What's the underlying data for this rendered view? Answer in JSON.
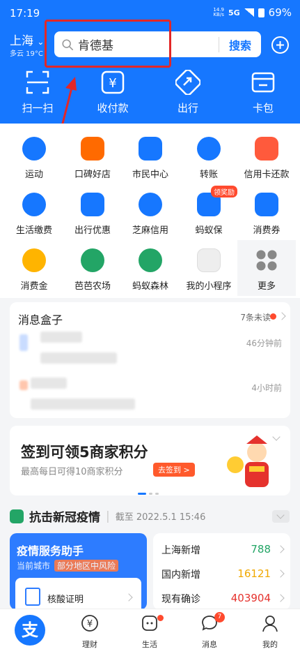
{
  "status": {
    "time": "17:19",
    "network_speed": "14.9",
    "network_unit": "KB/s",
    "signal": "5G",
    "battery": "69%"
  },
  "location": {
    "city": "上海",
    "weather": "多云 19°C"
  },
  "search": {
    "value": "肯德基",
    "button": "搜索"
  },
  "quick_actions": [
    "扫一扫",
    "收付款",
    "出行",
    "卡包"
  ],
  "grid": [
    {
      "label": "运动",
      "color": "#1677ff"
    },
    {
      "label": "口碑好店",
      "color": "#ff6a00"
    },
    {
      "label": "市民中心",
      "color": "#1677ff"
    },
    {
      "label": "转账",
      "color": "#1677ff"
    },
    {
      "label": "信用卡还款",
      "color": "#ff5a3c"
    },
    {
      "label": "生活缴费",
      "color": "#1677ff"
    },
    {
      "label": "出行优惠",
      "color": "#1677ff"
    },
    {
      "label": "芝麻信用",
      "color": "#1677ff"
    },
    {
      "label": "蚂蚁保",
      "color": "#1677ff",
      "badge": "领奖励"
    },
    {
      "label": "消费券",
      "color": "#1677ff"
    },
    {
      "label": "消费金",
      "color": "#ffb400"
    },
    {
      "label": "芭芭农场",
      "color": "#23a566"
    },
    {
      "label": "蚂蚁森林",
      "color": "#23a566"
    },
    {
      "label": "我的小程序",
      "color": "#eeeeee"
    },
    {
      "label": "更多",
      "color": "#888888"
    }
  ],
  "messages": {
    "title": "消息盒子",
    "unread": "7条未读",
    "items": [
      {
        "time": "46分钟前"
      },
      {
        "time": "4小时前"
      }
    ]
  },
  "promo": {
    "title": "签到可领5商家积分",
    "subtitle": "最高每日可得10商家积分",
    "button": "去签到 >"
  },
  "covid": {
    "title": "抗击新冠疫情",
    "date": "截至 2022.5.1 15:46",
    "assistant": {
      "title": "疫情服务助手",
      "city_label": "当前城市",
      "risk": "部分地区中风险",
      "item": "核酸证明"
    },
    "stats": [
      {
        "label": "上海新增",
        "value": "788",
        "color": "#23a566"
      },
      {
        "label": "国内新增",
        "value": "16121",
        "color": "#f0a800"
      },
      {
        "label": "现有确诊",
        "value": "403904",
        "color": "#e5322d"
      }
    ]
  },
  "tabs": [
    {
      "label": ""
    },
    {
      "label": "理财"
    },
    {
      "label": "生活"
    },
    {
      "label": "消息",
      "count": "7"
    },
    {
      "label": "我的"
    }
  ],
  "colors": {
    "brand": "#1677ff",
    "alert": "#e32727"
  }
}
